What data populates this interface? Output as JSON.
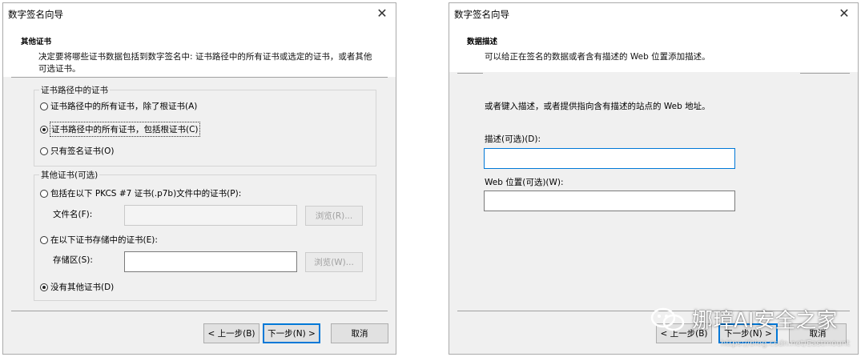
{
  "left_dialog": {
    "title": "数字签名向导",
    "header_title": "其他证书",
    "header_desc": "决定要将哪些证书数据包括到数字签名中: 证书路径中的所有证书或选定的证书，或者其他可选证书。",
    "group1_label": "证书路径中的证书",
    "opt_all_except_root": "证书路径中的所有证书，除了根证书(A)",
    "opt_all_including_root": "证书路径中的所有证书，包括根证书(C)",
    "opt_signing_only": "只有签名证书(O)",
    "group2_label": "其他证书(可选)",
    "opt_pkcs7": "包括在以下 PKCS #7 证书(.p7b)文件中的证书(P):",
    "file_name_label": "文件名(F):",
    "browse1": "浏览(R)...",
    "opt_store": "在以下证书存储中的证书(E):",
    "store_label": "存储区(S):",
    "browse2": "浏览(W)...",
    "opt_none": "没有其他证书(D)",
    "back": "< 上一步(B)",
    "next": "下一步(N) >",
    "cancel": "取消"
  },
  "right_dialog": {
    "title": "数字签名向导",
    "header_title": "数据描述",
    "header_desc": "可以给正在签名的数据或者含有描述的 Web 位置添加描述。",
    "body_text": "或者键入描述，或者提供指向含有描述的站点的 Web 地址。",
    "desc_label": "描述(可选)(D):",
    "desc_value": "",
    "web_label": "Web 位置(可选)(W):",
    "web_value": "",
    "back": "< 上一步(B)",
    "next": "下一步(N) >",
    "cancel": "取消"
  },
  "watermark": {
    "text": "娜璋AI安全之家",
    "url": "https://blog.csdn.net/Eastmount"
  }
}
